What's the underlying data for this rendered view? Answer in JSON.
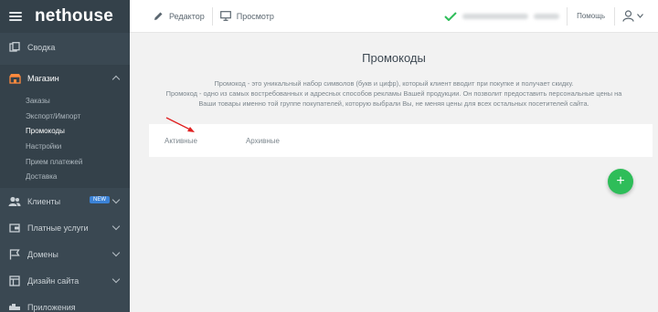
{
  "brand": {
    "logo": "nethouse"
  },
  "sidebar": {
    "items": [
      {
        "label": "Сводка",
        "icon": "dashboard-icon"
      },
      {
        "label": "Магазин",
        "icon": "store-icon"
      },
      {
        "label": "Клиенты",
        "icon": "users-icon"
      },
      {
        "label": "Платные услуги",
        "icon": "wallet-icon"
      },
      {
        "label": "Домены",
        "icon": "flag-icon"
      },
      {
        "label": "Дизайн сайта",
        "icon": "layout-icon"
      },
      {
        "label": "Приложения",
        "icon": "puzzle-icon"
      }
    ],
    "shop_sub": [
      "Заказы",
      "Экспорт/Импорт",
      "Промокоды",
      "Настройки",
      "Прием платежей",
      "Доставка"
    ],
    "clients_badge": "NEW"
  },
  "topbar": {
    "editor": "Редактор",
    "preview": "Просмотр",
    "help": "Помощь"
  },
  "main": {
    "title": "Промокоды",
    "desc1": "Промокод - это уникальный набор символов (букв и цифр), который клиент вводит при покупке и получает скидку.",
    "desc2": "Промокод - одно из самых востребованных и адресных способов рекламы Вашей продукции. Он позволит предоставить персональные цены на",
    "desc3": "Ваши товары именно той группе покупателей, которую выбрали Вы, не меняя цены для всех остальных посетителей сайта.",
    "tabs": [
      "Активные",
      "Архивные"
    ],
    "add": "+"
  },
  "colors": {
    "sidebar": "#3a4852",
    "accent": "#2ebd59",
    "arrow": "#e02020",
    "badge": "#3b82d6"
  }
}
